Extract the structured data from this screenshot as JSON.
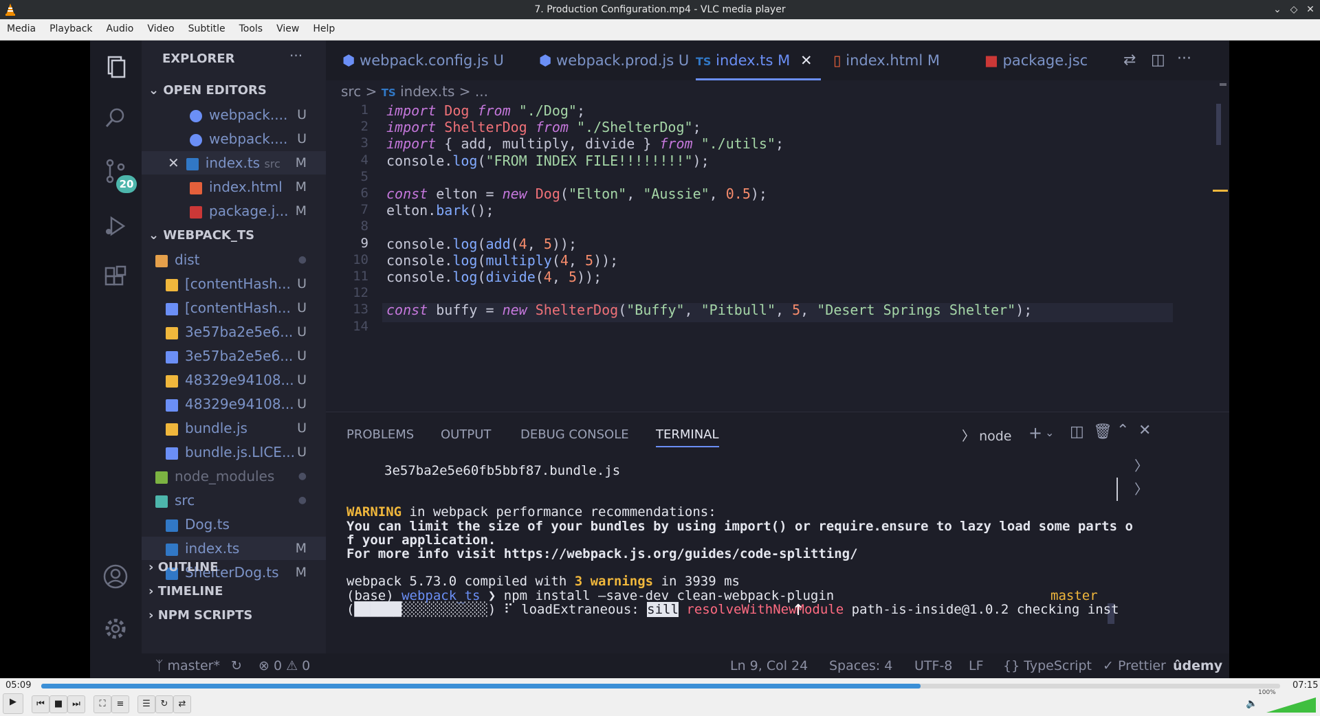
{
  "window": {
    "title": "7. Production Configuration.mp4 - VLC media player"
  },
  "menu": [
    "Media",
    "Playback",
    "Audio",
    "Video",
    "Subtitle",
    "Tools",
    "View",
    "Help"
  ],
  "vscode": {
    "activity": {
      "scm_badge": "20"
    },
    "sidebar": {
      "explorer_title": "EXPLORER",
      "more": "···",
      "open_editors_label": "OPEN EDITORS",
      "open_editors": [
        {
          "name": "webpack....",
          "status": "U"
        },
        {
          "name": "webpack....",
          "status": "U"
        },
        {
          "name": "index.ts",
          "sub": "src",
          "status": "M",
          "close": "✕"
        },
        {
          "name": "index.html",
          "status": "M"
        },
        {
          "name": "package.j...",
          "status": "M"
        }
      ],
      "project_label": "WEBPACK_TS",
      "tree": [
        {
          "name": "dist",
          "status": "●"
        },
        {
          "name": "[contentHash...",
          "status": "U"
        },
        {
          "name": "[contentHash...",
          "status": "U"
        },
        {
          "name": "3e57ba2e5e6...",
          "status": "U"
        },
        {
          "name": "3e57ba2e5e6...",
          "status": "U"
        },
        {
          "name": "48329e94108...",
          "status": "U"
        },
        {
          "name": "48329e94108...",
          "status": "U"
        },
        {
          "name": "bundle.js",
          "status": "U"
        },
        {
          "name": "bundle.js.LICE...",
          "status": "U"
        },
        {
          "name": "node_modules",
          "status": "●"
        },
        {
          "name": "src",
          "status": "●"
        },
        {
          "name": "Dog.ts",
          "status": ""
        },
        {
          "name": "index.ts",
          "status": "M"
        },
        {
          "name": "ShelterDog.ts",
          "status": "M"
        }
      ],
      "outline_label": "OUTLINE",
      "timeline_label": "TIMELINE",
      "npm_label": "NPM SCRIPTS"
    },
    "tabs": [
      {
        "name": "webpack.config.js",
        "status": "U"
      },
      {
        "name": "webpack.prod.js",
        "status": "U"
      },
      {
        "name": "index.ts",
        "status": "M",
        "close": "✕"
      },
      {
        "name": "index.html",
        "status": "M"
      },
      {
        "name": "package.jsc"
      }
    ],
    "breadcrumb": {
      "folder": "src",
      "sep": ">",
      "file": "index.ts",
      "more": "..."
    },
    "code_lines": [
      {
        "n": "1",
        "t": "import Dog from \"./Dog\";"
      },
      {
        "n": "2",
        "t": "import ShelterDog from \"./ShelterDog\";"
      },
      {
        "n": "3",
        "t": "import { add, multiply, divide } from \"./utils\";"
      },
      {
        "n": "4",
        "t": "console.log(\"FROM INDEX FILE!!!!!!!!\");"
      },
      {
        "n": "5",
        "t": ""
      },
      {
        "n": "6",
        "t": "const elton = new Dog(\"Elton\", \"Aussie\", 0.5);"
      },
      {
        "n": "7",
        "t": "elton.bark();"
      },
      {
        "n": "8",
        "t": ""
      },
      {
        "n": "9",
        "t": "console.log(add(4, 5));"
      },
      {
        "n": "10",
        "t": "console.log(multiply(4, 5));"
      },
      {
        "n": "11",
        "t": "console.log(divide(4, 5));"
      },
      {
        "n": "12",
        "t": ""
      },
      {
        "n": "13",
        "t": "const buffy = new ShelterDog(\"Buffy\", \"Pitbull\", 5, \"Desert Springs Shelter\");"
      },
      {
        "n": "14",
        "t": ""
      }
    ],
    "panel": {
      "tabs": [
        "PROBLEMS",
        "OUTPUT",
        "DEBUG CONSOLE",
        "TERMINAL"
      ],
      "active_tab": "TERMINAL",
      "shell": "node",
      "terminal": {
        "l1": "3e57ba2e5e60fb5bbf87.bundle.js",
        "warn_word": "WARNING",
        "l2_rest": " in webpack performance recommendations:",
        "l3": "You can limit the size of your bundles by using import() or require.ensure to lazy load some parts o",
        "l4": "f your application.",
        "l5": "For more info visit https://webpack.js.org/guides/code-splitting/",
        "l6_a": "webpack 5.73.0 compiled with ",
        "l6_warn": "3 warnings",
        "l6_b": " in 3939 ms",
        "l7_base": "(base) ",
        "l7_path": "webpack_ts",
        "l7_cmd": " ❯ npm install —save-dev clean-webpack-plugin",
        "l7_branch": "master",
        "l8_a": "(██████░░░░░░░░░░░) ⠏ loadExtraneous: ",
        "l8_sill": "sill",
        "l8_fn": " resolveWithNewModule",
        "l8_b": " path-is-inside@1.0.2 checking inst"
      }
    },
    "status": {
      "branch": "master*",
      "errors": "⊗ 0 ⚠ 0",
      "cursor": "Ln 9, Col 24",
      "spaces": "Spaces: 4",
      "encoding": "UTF-8",
      "eol": "LF",
      "lang": "{} TypeScript",
      "prettier": "✓ Prettier",
      "watermark": "ûdemy"
    }
  },
  "player": {
    "elapsed": "05:09",
    "total": "07:15",
    "progress": 0.71,
    "volume": "100%",
    "volume_level": 1.0
  }
}
